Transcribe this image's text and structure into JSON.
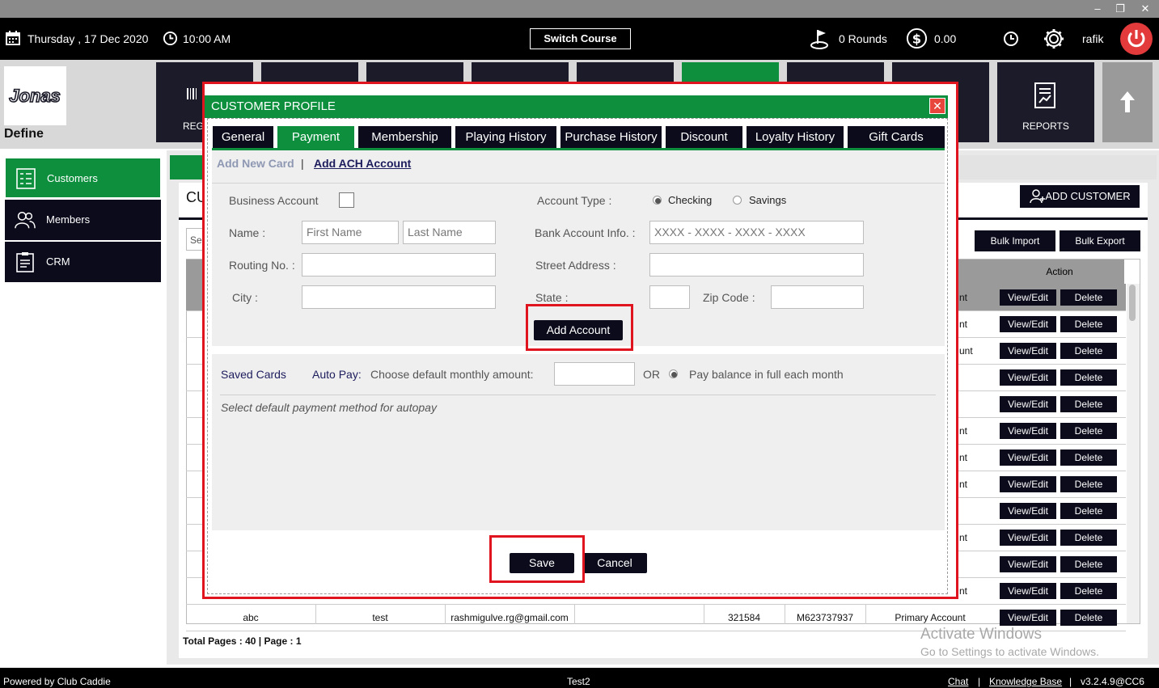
{
  "topbar": {
    "date": "Thursday ,  17 Dec 2020",
    "time": "10:00 AM",
    "switch_course": "Switch Course",
    "rounds": "0 Rounds",
    "amount": "0.00",
    "user": "rafik"
  },
  "window_controls": {
    "minimize": "–",
    "restore": "❐",
    "close": "✕"
  },
  "logo_text": "Jonas",
  "define_label": "Define",
  "tiles": {
    "registration_partial": "REG",
    "reports": "REPORTS"
  },
  "sidebar": {
    "items": [
      {
        "label": "Customers",
        "active": true
      },
      {
        "label": "Members",
        "active": false
      },
      {
        "label": "CRM",
        "active": false
      }
    ]
  },
  "main": {
    "title_partial": "CU",
    "search_partial": "Se",
    "add_customer": "ADD CUSTOMER",
    "bulk_import": "Bulk Import",
    "bulk_export": "Bulk Export",
    "action_header": "Action",
    "view_edit": "View/Edit",
    "delete": "Delete",
    "row_partials": [
      "nt",
      "nt",
      "unt",
      "",
      "",
      "nt",
      "nt",
      "nt",
      "",
      "nt",
      "",
      "nt"
    ],
    "last_row": {
      "first": "abc",
      "last": "test",
      "email": "rashmigulve.rg@gmail.com",
      "number": "321584",
      "member_id": "M623737937",
      "account": "Primary Account"
    },
    "pager": "Total Pages : 40 | Page : 1"
  },
  "activate_windows": {
    "line1": "Activate Windows",
    "line2": "Go to Settings to activate Windows."
  },
  "bottombar": {
    "powered": "Powered by Club Caddie",
    "center": "Test2",
    "chat": "Chat",
    "sep1": "|",
    "kb": "Knowledge Base",
    "sep2": "|",
    "version": "v3.2.4.9@CC6"
  },
  "modal": {
    "title": "CUSTOMER PROFILE",
    "close": "✕",
    "tabs": [
      "General",
      "Payment",
      "Membership",
      "Playing History",
      "Purchase History",
      "Discount",
      "Loyalty History",
      "Gift Cards"
    ],
    "active_tab": "Payment",
    "subtabs": {
      "add_card": "Add New Card",
      "sep": "|",
      "add_ach": "Add ACH Account"
    },
    "form": {
      "business_account": "Business Account",
      "name_label": "Name :",
      "first_name_ph": "First Name",
      "last_name_ph": "Last Name",
      "routing_label": "Routing No. :",
      "city_label": "City :",
      "account_type_label": "Account Type :",
      "checking": "Checking",
      "savings": "Savings",
      "bank_info_label": "Bank Account Info. :",
      "bank_info_ph": "XXXX - XXXX - XXXX - XXXX",
      "street_label": "Street Address :",
      "state_label": "State :",
      "zip_label": "Zip Code :",
      "add_account": "Add Account"
    },
    "saved": {
      "saved_cards": "Saved Cards",
      "auto_pay": "Auto Pay:",
      "choose": "Choose default monthly amount:",
      "or": "OR",
      "pay_full": "Pay balance in full each month",
      "select_default": "Select default payment method for autopay"
    },
    "save": "Save",
    "cancel": "Cancel"
  },
  "colors": {
    "accent_green": "#0d8f3d",
    "dark": "#0b0b1c",
    "highlight_red": "#e0141e"
  }
}
